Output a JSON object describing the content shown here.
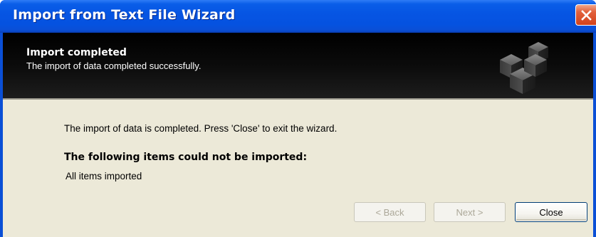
{
  "window": {
    "title": "Import from Text File Wizard"
  },
  "banner": {
    "title": "Import completed",
    "subtitle": "The import of data completed successfully.",
    "icon": "cubes-icon"
  },
  "content": {
    "message": "The import of data is completed. Press 'Close' to exit the wizard.",
    "section_heading": "The following items could not be imported:",
    "result_text": "All items imported"
  },
  "buttons": {
    "back_label": "< Back",
    "next_label": "Next >",
    "close_label": "Close"
  },
  "colors": {
    "titlebar": "#0655e3",
    "banner": "#000000",
    "dialog_background": "#ece9d8",
    "close_accent": "#d2421c"
  }
}
